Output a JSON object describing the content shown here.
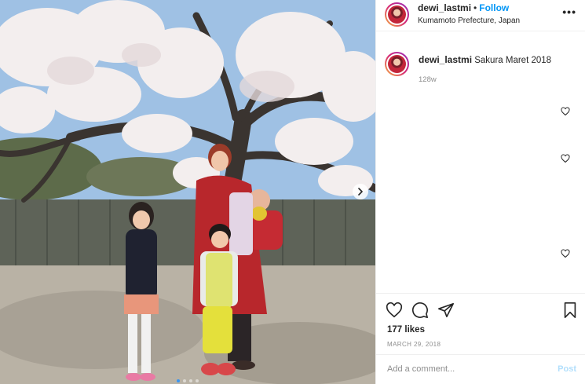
{
  "post": {
    "username": "dewi_lastmi",
    "follow_label": "Follow",
    "separator": "•",
    "location": "Kumamoto Prefecture, Japan",
    "more_label": "•••",
    "caption_text": "Sakura Maret 2018",
    "caption_time": "128w",
    "likes_text": "177 likes",
    "date_text": "MARCH 29, 2018",
    "comment_placeholder": "Add a comment...",
    "post_label": "Post",
    "carousel": {
      "total": 4,
      "active": 1
    }
  },
  "icons": {
    "like": "heart-icon",
    "comment": "comment-icon",
    "share": "share-icon",
    "save": "bookmark-icon",
    "next": "chevron-right-icon",
    "more": "more-options-icon"
  },
  "colors": {
    "link": "#0095f6",
    "muted": "#8e8e8e",
    "post_disabled": "#b2dffc",
    "text": "#262626"
  }
}
